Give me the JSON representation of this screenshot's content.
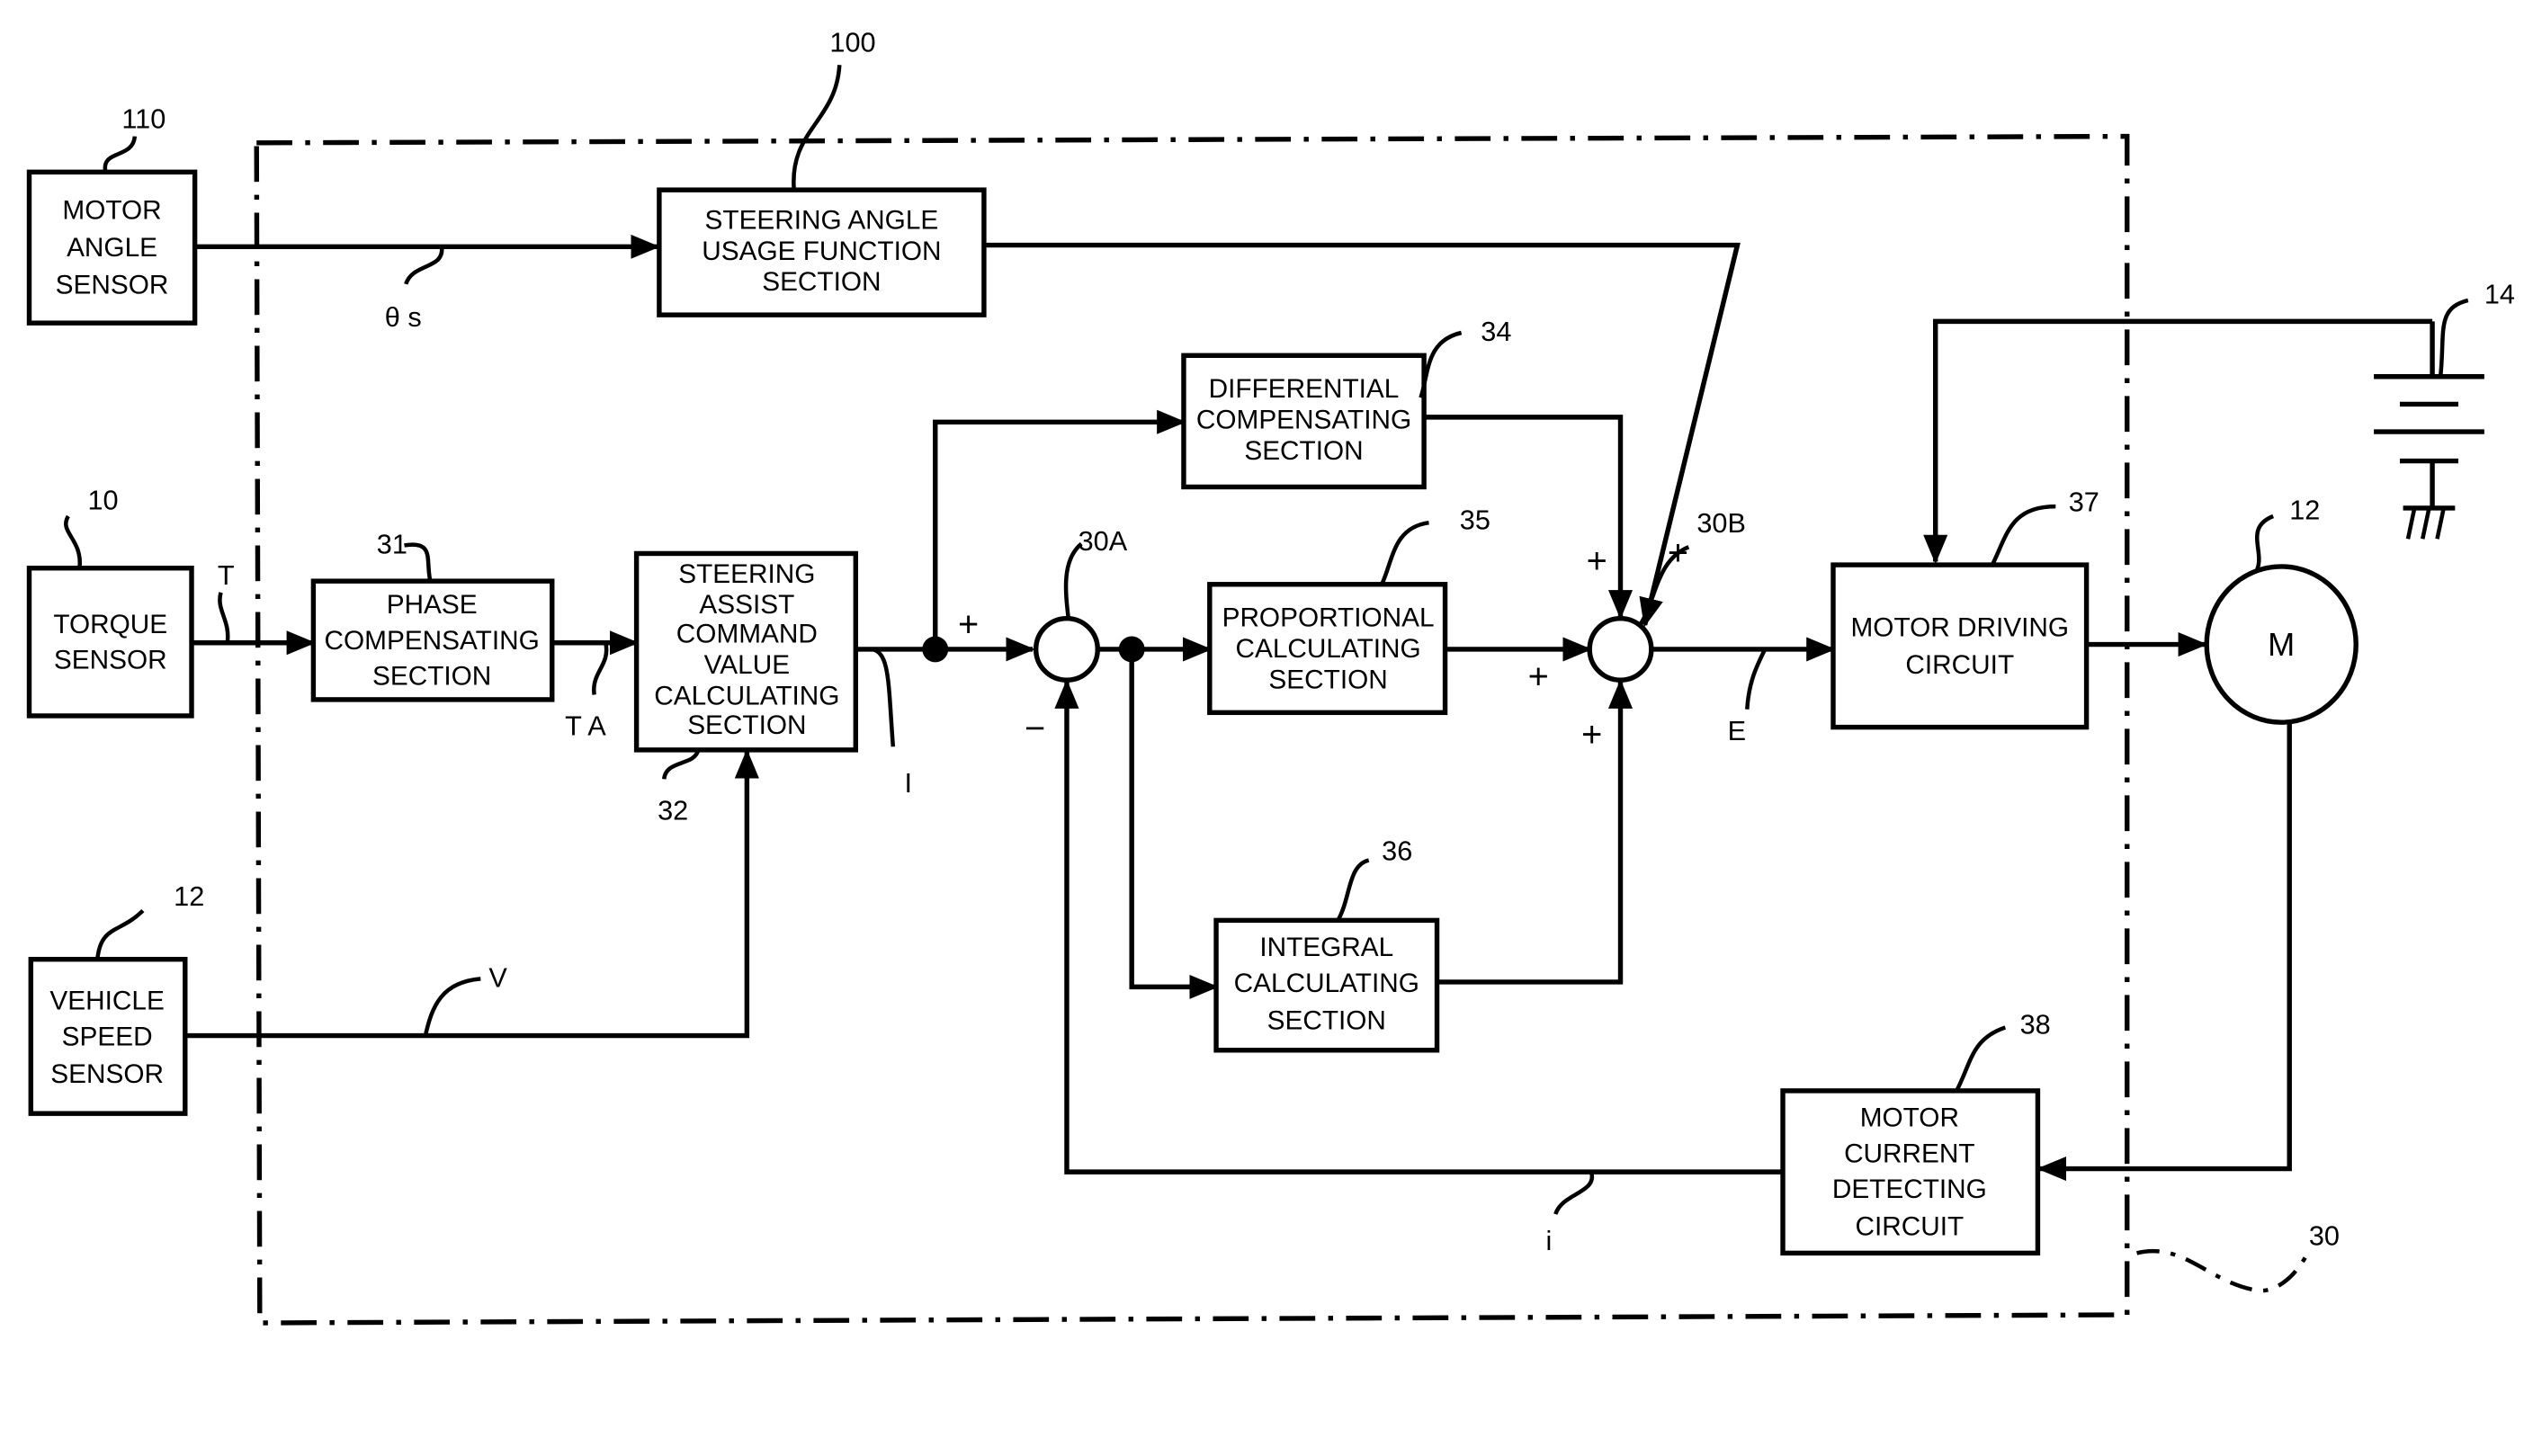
{
  "diagram": {
    "type": "block-diagram",
    "title": "Electric power steering control device block diagram",
    "controller_ref": "30",
    "blocks": {
      "motor_angle_sensor": {
        "ref": "110",
        "lines": [
          "MOTOR",
          "ANGLE",
          "SENSOR"
        ]
      },
      "steering_angle_usage": {
        "ref": "100",
        "lines": [
          "STEERING ANGLE",
          "USAGE FUNCTION",
          "SECTION"
        ]
      },
      "torque_sensor": {
        "ref": "10",
        "lines": [
          "TORQUE",
          "SENSOR"
        ]
      },
      "phase_compensating": {
        "ref": "31",
        "lines": [
          "PHASE",
          "COMPENSATING",
          "SECTION"
        ]
      },
      "steering_assist": {
        "ref": "32",
        "lines": [
          "STEERING",
          "ASSIST",
          "COMMAND",
          "VALUE",
          "CALCULATING",
          "SECTION"
        ]
      },
      "vehicle_speed_sensor": {
        "ref": "12",
        "lines": [
          "VEHICLE",
          "SPEED",
          "SENSOR"
        ]
      },
      "differential_compensating": {
        "ref": "34",
        "lines": [
          "DIFFERENTIAL",
          "COMPENSATING",
          "SECTION"
        ]
      },
      "proportional_calculating": {
        "ref": "35",
        "lines": [
          "PROPORTIONAL",
          "CALCULATING",
          "SECTION"
        ]
      },
      "integral_calculating": {
        "ref": "36",
        "lines": [
          "INTEGRAL",
          "CALCULATING",
          "SECTION"
        ]
      },
      "motor_driving_circuit": {
        "ref": "37",
        "lines": [
          "MOTOR DRIVING",
          "CIRCUIT"
        ]
      },
      "motor_current_detecting": {
        "ref": "38",
        "lines": [
          "MOTOR",
          "CURRENT",
          "DETECTING",
          "CIRCUIT"
        ]
      },
      "motor": {
        "ref": "12",
        "label": "M"
      },
      "battery": {
        "ref": "14"
      }
    },
    "junctions": {
      "sum_a": {
        "ref": "30A",
        "signs": [
          "+",
          "−"
        ]
      },
      "sum_b": {
        "ref": "30B",
        "signs": [
          "+",
          "+",
          "+",
          "+"
        ]
      }
    },
    "signals": {
      "theta_s": "θ s",
      "torque": "T",
      "torque_adjusted": "T A",
      "current_command": "I",
      "vehicle_speed": "V",
      "voltage": "E",
      "motor_current": "i"
    }
  }
}
